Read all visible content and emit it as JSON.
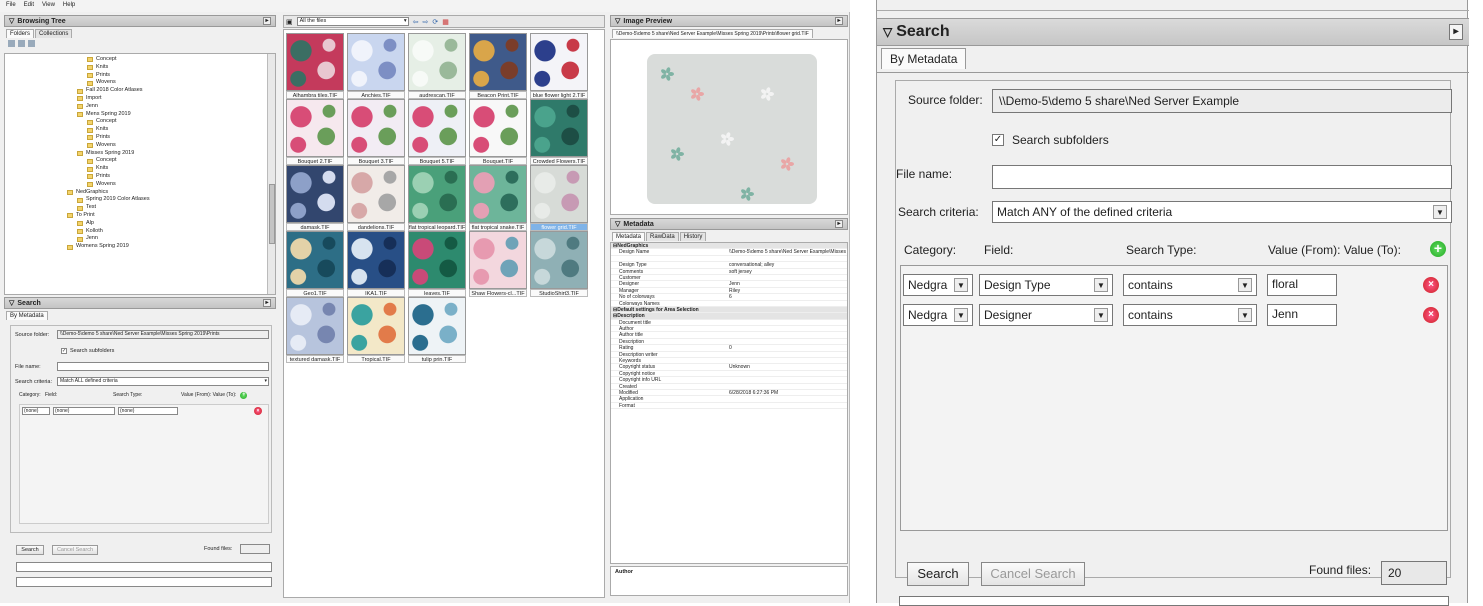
{
  "menu": [
    "File",
    "Edit",
    "View",
    "Help"
  ],
  "browsing_tree": {
    "title": "Browsing Tree",
    "tabs": [
      "Folders",
      "Collections"
    ],
    "items": [
      [
        "Concept",
        2
      ],
      [
        "Knits",
        2
      ],
      [
        "Prints",
        2
      ],
      [
        "Wovens",
        2
      ],
      [
        "Fall 2018 Color Atlases",
        1
      ],
      [
        "Import",
        1
      ],
      [
        "Jenn",
        1
      ],
      [
        "Mens Spring 2019",
        1
      ],
      [
        "Concept",
        2
      ],
      [
        "Knits",
        2
      ],
      [
        "Prints",
        2
      ],
      [
        "Wovens",
        2
      ],
      [
        "Misses Spring 2019",
        1
      ],
      [
        "Concept",
        2
      ],
      [
        "Knits",
        2
      ],
      [
        "Prints",
        2
      ],
      [
        "Wovens",
        2
      ],
      [
        "NedGraphics",
        0
      ],
      [
        "Spring 2019 Color Atlases",
        1
      ],
      [
        "Test",
        1
      ],
      [
        "To Print",
        0
      ],
      [
        "Alp",
        1
      ],
      [
        "Kolloth",
        1
      ],
      [
        "Jenn",
        1
      ],
      [
        "Womens Spring 2019",
        0
      ]
    ]
  },
  "toolbar": {
    "folder_select": "All the files"
  },
  "thumbnails": [
    {
      "label": "Alhambra tiles.TIF",
      "colors": [
        "#c43a5c",
        "#3b6e63",
        "#e8c7d0"
      ]
    },
    {
      "label": "Anchies.TIF",
      "colors": [
        "#c9d6ef",
        "#f0f3fb",
        "#7d8fc4"
      ]
    },
    {
      "label": "audrescan.TIF",
      "colors": [
        "#e6efe6",
        "#f7faf7",
        "#9ab99a"
      ]
    },
    {
      "label": "Beacon Print.TIF",
      "colors": [
        "#3f5a8a",
        "#d9a54a",
        "#7a3d2a"
      ]
    },
    {
      "label": "blue flower light 2.TIF",
      "colors": [
        "#f4f4f8",
        "#2c3f8c",
        "#c83a48"
      ]
    },
    {
      "label": "Bouquet 2.TIF",
      "colors": [
        "#f6e8ee",
        "#d84d77",
        "#6a9e5a"
      ]
    },
    {
      "label": "Bouquet 3.TIF",
      "colors": [
        "#f2ecf4",
        "#d84d77",
        "#6a9e5a"
      ]
    },
    {
      "label": "Bouquet 5.TIF",
      "colors": [
        "#eef0f6",
        "#d84d77",
        "#6a9e5a"
      ]
    },
    {
      "label": "Bouquet.TIF",
      "colors": [
        "#f8f8f8",
        "#d84d77",
        "#6a9e5a"
      ]
    },
    {
      "label": "Crowded Flowers.TIF",
      "colors": [
        "#2f7a6a",
        "#4aa38c",
        "#1d4e45"
      ]
    },
    {
      "label": "damask.TIF",
      "colors": [
        "#32466e",
        "#8da0c8",
        "#d4dcef"
      ]
    },
    {
      "label": "dandelions.TIF",
      "colors": [
        "#f1ece8",
        "#d7a8a8",
        "#a7a7a7"
      ]
    },
    {
      "label": "flat tropical leopard.TIF",
      "colors": [
        "#4aa07a",
        "#9bd0b3",
        "#2a6e52"
      ]
    },
    {
      "label": "flat tropical snake.TIF",
      "colors": [
        "#6db59a",
        "#e3a0b4",
        "#2d6e5c"
      ]
    },
    {
      "label": "flower grid.TIF",
      "colors": [
        "#d7dbd7",
        "#e8ebe8",
        "#c79ab4"
      ]
    },
    {
      "label": "Geo1.TIF",
      "colors": [
        "#2d6e86",
        "#e3d2a8",
        "#174a5c"
      ]
    },
    {
      "label": "IKA1.TIF",
      "colors": [
        "#284f86",
        "#d7e3ef",
        "#162f58"
      ]
    },
    {
      "label": "leaves.TIF",
      "colors": [
        "#2d8a6e",
        "#c94a78",
        "#145a44"
      ]
    },
    {
      "label": "Shaw Flowers-cl...TIF",
      "colors": [
        "#f3d7de",
        "#e79ab0",
        "#6fa3b8"
      ]
    },
    {
      "label": "StudioShirt3.TIF",
      "colors": [
        "#8fb0b5",
        "#c7d8da",
        "#4f7a80"
      ]
    },
    {
      "label": "textured damask.TIF",
      "colors": [
        "#b7c4dd",
        "#e6ebf5",
        "#7786b0"
      ]
    },
    {
      "label": "Tropical.TIF",
      "colors": [
        "#f3e8c8",
        "#3aa3a0",
        "#e27b4a"
      ]
    },
    {
      "label": "tulip prin.TIF",
      "colors": [
        "#eef3f6",
        "#2b6e8f",
        "#7ab0c8"
      ]
    }
  ],
  "preview": {
    "title": "Image Preview",
    "path": "\\\\Demo-5\\demo 5 share\\Ned Server Example\\Misses Spring 2019\\Prints\\flower grid.TIF"
  },
  "metadata": {
    "title": "Metadata",
    "tabs": [
      "Metadata",
      "RawData",
      "History"
    ],
    "rows": [
      [
        "NedGraphics",
        "",
        1
      ],
      [
        "Design Name",
        "\\\\Demo-5\\demo 5 share\\Ned Server Example\\Misses Spring 2019\\Prints\\flower grid.TIF",
        0
      ],
      [
        "",
        "",
        0
      ],
      [
        "Design Type",
        "conversational; alley",
        0
      ],
      [
        "Comments",
        "soft jersey",
        0
      ],
      [
        "Customer",
        "",
        0
      ],
      [
        "Designer",
        "Jenn",
        0
      ],
      [
        "Manager",
        "Riley",
        0
      ],
      [
        "No of colorways",
        "6",
        0
      ],
      [
        "Colorways Names",
        "",
        0
      ],
      [
        "Default settings for Area Selection",
        "",
        1
      ],
      [
        "Description",
        "",
        1
      ],
      [
        "Document title",
        "",
        0
      ],
      [
        "Author",
        "",
        0
      ],
      [
        "Author title",
        "",
        0
      ],
      [
        "Description",
        "",
        0
      ],
      [
        "Rating",
        "0",
        0
      ],
      [
        "Description writer",
        "",
        0
      ],
      [
        "Keywords",
        "",
        0
      ],
      [
        "Copyright status",
        "Unknown",
        0
      ],
      [
        "Copyright notice",
        "",
        0
      ],
      [
        "Copyright info URL",
        "",
        0
      ],
      [
        "Created",
        "",
        0
      ],
      [
        "Modified",
        "6/28/2018 6:27:36 PM",
        0
      ],
      [
        "Application",
        "",
        0
      ],
      [
        "Format",
        "",
        0
      ]
    ],
    "footer": "Author"
  },
  "small_search": {
    "title": "Search",
    "tab": "By Metadata",
    "source_label": "Source folder:",
    "source_value": "\\\\Demo-5\\demo 5 share\\Ned Server Example\\Misses Spring 2019\\Prints",
    "subfolders": "Search subfolders",
    "file_label": "File name:",
    "criteria_label": "Search criteria:",
    "criteria_value": "Match ALL defined criteria",
    "col_category": "Category:",
    "col_field": "Field:",
    "col_type": "Search Type:",
    "col_value": "Value (From): Value (To):",
    "row_cat": "(none)",
    "row_field": "(none)",
    "row_type": "(none)",
    "search_btn": "Search",
    "cancel_btn": "Cancel Search",
    "found_label": "Found files:"
  },
  "zoom_search": {
    "title": "Search",
    "tab": "By Metadata",
    "source_label": "Source folder:",
    "source_value": "\\\\Demo-5\\demo 5 share\\Ned Server Example",
    "subfolders": "Search subfolders",
    "file_label": "File name:",
    "criteria_label": "Search criteria:",
    "criteria_value": "Match ANY of the defined criteria",
    "col_category": "Category:",
    "col_field": "Field:",
    "col_type": "Search Type:",
    "col_value": "Value (From): Value (To):",
    "rows": [
      {
        "cat": "Nedgra",
        "field": "Design Type",
        "type": "contains",
        "value": "floral"
      },
      {
        "cat": "Nedgra",
        "field": "Designer",
        "type": "contains",
        "value": "Jenn"
      }
    ],
    "search_btn": "Search",
    "cancel_btn": "Cancel Search",
    "found_label": "Found files:",
    "found_value": "20"
  }
}
